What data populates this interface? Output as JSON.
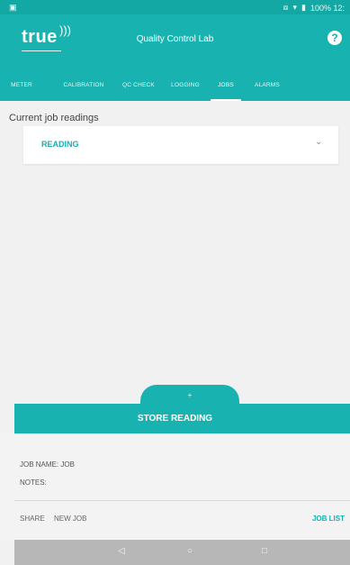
{
  "status_bar": {
    "left_icon": "▣",
    "right_text": "100% 12:",
    "icons": [
      "vibrate-icon",
      "wifi-icon",
      "battery-icon"
    ]
  },
  "app_bar": {
    "logo": "true",
    "title": "Quality Control Lab",
    "help_icon": "?"
  },
  "tabs": [
    {
      "label": "METER"
    },
    {
      "label": "CALIBRATION"
    },
    {
      "label": "QC CHECK"
    },
    {
      "label": "LOGGING"
    },
    {
      "label": "JOBS",
      "active": true
    },
    {
      "label": "ALARMS"
    }
  ],
  "main": {
    "section_label": "Current job readings",
    "reading_label": "READING"
  },
  "store": {
    "label": "STORE READING",
    "plus": "+",
    "minus": "-"
  },
  "bottom": {
    "job_name": "JOB NAME: JOB",
    "notes": "NOTES:",
    "share": "SHARE",
    "new_job": "NEW JOB",
    "job_list": "JOB LIST"
  },
  "nav_bar": {
    "back": "◁",
    "home": "○",
    "recent": "□"
  },
  "colors": {
    "teal": "#18b3b0",
    "teal_dark": "#14a8a5",
    "accent_text": "#19aeb0"
  }
}
